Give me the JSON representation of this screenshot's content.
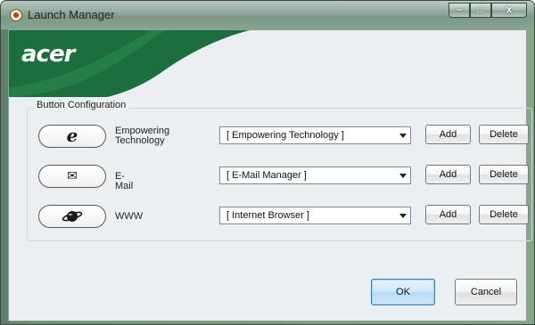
{
  "window": {
    "title": "Launch Manager",
    "controls": {
      "minimize": "–",
      "maximize": "□",
      "close": "x"
    }
  },
  "banner": {
    "logo_text": "acer",
    "colors": {
      "banner_green": "#1d6e3e",
      "banner_light": "#ffffff"
    }
  },
  "group": {
    "label": "Button Configuration",
    "rows": [
      {
        "icon": "ie-icon",
        "icon_glyph": "e",
        "label_line1": "Empowering",
        "label_line2": "Technology",
        "selected": "[ Empowering Technology ]",
        "add_label": "Add",
        "delete_label": "Delete"
      },
      {
        "icon": "mail-icon",
        "icon_glyph": "✉",
        "label_line1": "E-Mail",
        "label_line2": "",
        "selected": "[ E-Mail Manager ]",
        "add_label": "Add",
        "delete_label": "Delete"
      },
      {
        "icon": "globe-icon",
        "icon_glyph": "🪐",
        "label_line1": "WWW",
        "label_line2": "",
        "selected": "[ Internet Browser ]",
        "add_label": "Add",
        "delete_label": "Delete"
      }
    ]
  },
  "footer": {
    "ok_label": "OK",
    "cancel_label": "Cancel"
  }
}
